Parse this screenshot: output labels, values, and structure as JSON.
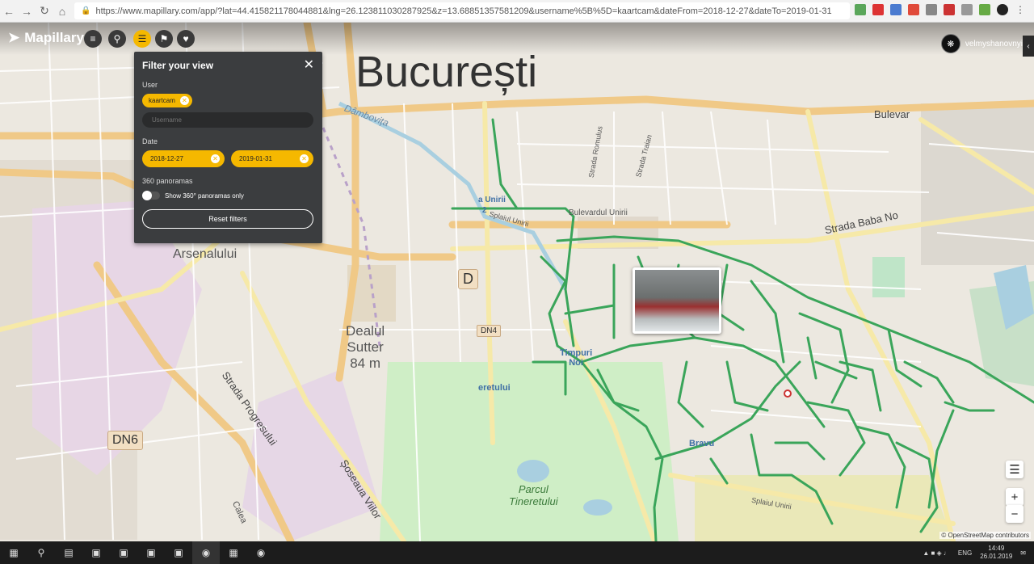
{
  "browser": {
    "url": "https://www.mapillary.com/app/?lat=44.415821178044881&lng=26.123811030287925&z=13.68851357581209&username%5B%5D=kaartcam&dateFrom=2018-12-27&dateTo=2019-01-31"
  },
  "header": {
    "logo": "Mapillary",
    "user_name": "velmyshanovnyi"
  },
  "filter_panel": {
    "title": "Filter your view",
    "user_label": "User",
    "user_tag": "kaartcam",
    "username_placeholder": "Username",
    "date_label": "Date",
    "date_from": "2018-12-27",
    "date_to": "2019-01-31",
    "panoramas_label": "360 panoramas",
    "panoramas_toggle_label": "Show 360° panoramas only",
    "reset_button": "Reset filters"
  },
  "map": {
    "city": "București",
    "labels": {
      "dambovita": "Dâmbovița",
      "bulevardul_unirii": "Bulevardul Unirii",
      "splaiul_unirii_top": "Splaiul Unirii",
      "splaiul_unirii_bottom": "Splaiul Unirii",
      "strada_romulus": "Strada Romulus",
      "strada_traian": "Strada Traian",
      "strada_baba_novac": "Strada Baba No",
      "bulevar": "Bulevar",
      "dealul_arsenalului": "Dealul\nArsenalului",
      "dealul_sutter": "Dealul\nSutter\n84 m",
      "strada_progresului": "Strada Progresului",
      "soseaua_viilor": "Șoseaua Viilor",
      "calea_rahovei": "Calea",
      "dn6": "DN6",
      "dn4": "DN4",
      "d_badge": "D",
      "timpuri_noi": "Timpuri\nNoi",
      "eroii_revolutiei": "eretului",
      "parcul_tineretului": "Parcul\nTineretului",
      "piata_unirii": "a Unirii",
      "unirii_2": "2",
      "brau": "Bravu"
    },
    "attribution": "© OpenStreetMap contributors",
    "accent_color": "#f5b800",
    "sequence_color": "#3aa55a"
  },
  "taskbar": {
    "language": "ENG",
    "time": "14:49",
    "date": "26.01.2019"
  }
}
